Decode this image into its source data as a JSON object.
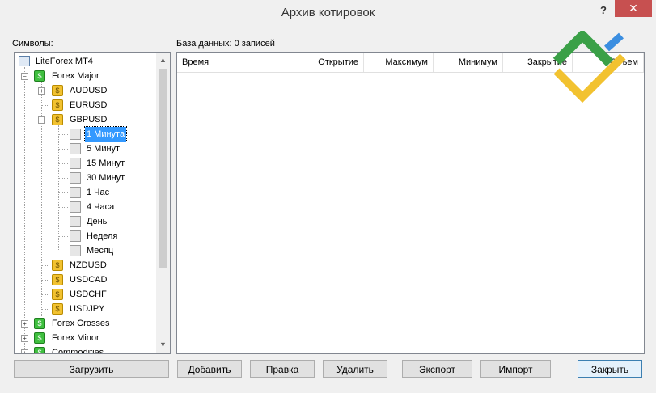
{
  "window": {
    "title": "Архив котировок",
    "help": "?",
    "close": "✕"
  },
  "labels": {
    "symbols": "Символы:",
    "database": "База данных: 0 записей"
  },
  "tree": {
    "root": "LiteForex MT4",
    "group_major": "Forex Major",
    "audusd": "AUDUSD",
    "eurusd": "EURUSD",
    "gbpusd": "GBPUSD",
    "tf": [
      "1 Минута",
      "5 Минут",
      "15 Минут",
      "30 Минут",
      "1 Час",
      "4 Часа",
      "День",
      "Неделя",
      "Месяц"
    ],
    "nzdusd": "NZDUSD",
    "usdcad": "USDCAD",
    "usdchf": "USDCHF",
    "usdjpy": "USDJPY",
    "group_crosses": "Forex Crosses",
    "group_minor": "Forex Minor",
    "group_commodities": "Commodities"
  },
  "grid": {
    "columns": [
      "Время",
      "Открытие",
      "Максимум",
      "Минимум",
      "Закрытие",
      "Объем"
    ]
  },
  "buttons": {
    "load": "Загрузить",
    "add": "Добавить",
    "edit": "Правка",
    "delete": "Удалить",
    "export": "Экспорт",
    "import": "Импорт",
    "close": "Закрыть"
  },
  "colors": {
    "selection": "#3399ff",
    "close_button": "#c75050",
    "logo_green": "#3aa047",
    "logo_yellow": "#f2c230",
    "logo_blue": "#3b8ee0"
  },
  "icons": {
    "close": "close-icon",
    "help": "help-icon",
    "coin": "dollar-coin-icon",
    "database": "database-icon"
  }
}
